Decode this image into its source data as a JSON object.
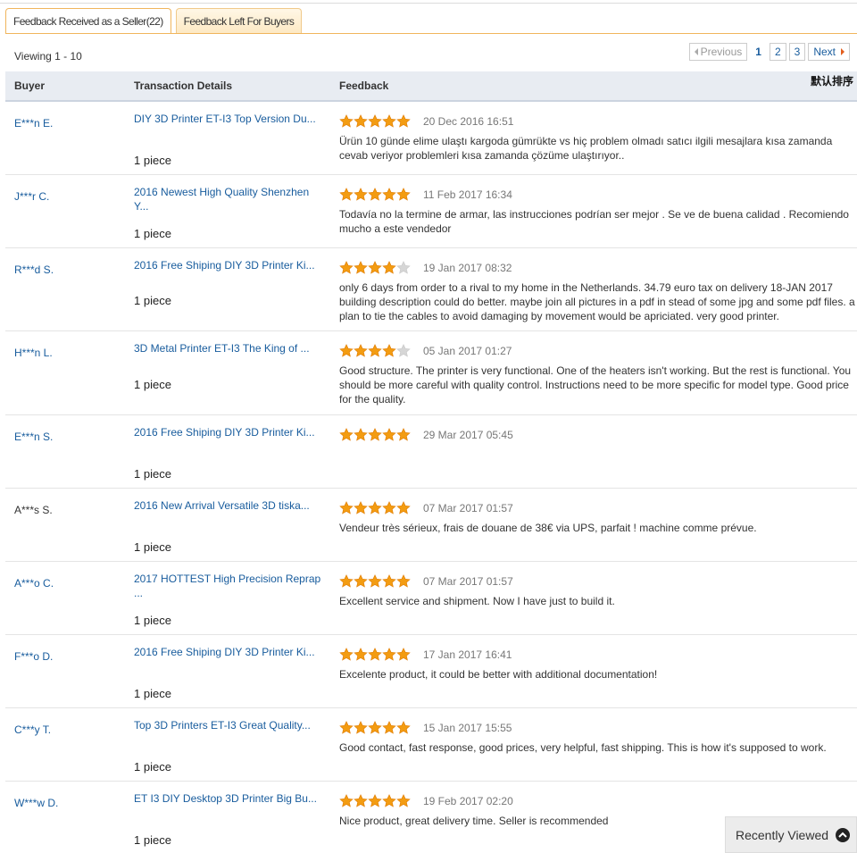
{
  "tabs": [
    {
      "label": "Feedback Received as a Seller(22)",
      "active": true
    },
    {
      "label": "Feedback Left For Buyers",
      "active": false
    }
  ],
  "viewing": "Viewing 1 - 10",
  "pager": {
    "prev": "Previous",
    "pages": [
      "1",
      "2",
      "3"
    ],
    "current": "1",
    "next": "Next"
  },
  "sort_label": "默认排序",
  "table": {
    "headers": {
      "buyer": "Buyer",
      "transaction": "Transaction Details",
      "feedback": "Feedback"
    },
    "rows": [
      {
        "buyer": "E***n E.",
        "buyer_link": true,
        "transaction": "DIY 3D Printer ET-I3 Top Version Du...",
        "quantity": "1 piece",
        "stars": 5,
        "date": "20 Dec 2016 16:51",
        "comment": "Ürün 10 günde elime ulaştı kargoda gümrükte vs hiç problem olmadı satıcı ilgili mesajlara kısa zamanda cevab veriyor problemleri kısa zamanda çözüme ulaştırıyor.."
      },
      {
        "buyer": "J***r C.",
        "buyer_link": true,
        "transaction": "2016 Newest High Quality Shenzhen Y...",
        "quantity": "1 piece",
        "stars": 5,
        "date": "11 Feb 2017 16:34",
        "comment": "Todavía no la termine de armar, las instrucciones podrían ser mejor . Se ve de buena calidad . Recomiendo mucho a este vendedor"
      },
      {
        "buyer": "R***d S.",
        "buyer_link": true,
        "transaction": "2016 Free Shiping DIY 3D Printer Ki...",
        "quantity": "1 piece",
        "stars": 4,
        "date": "19 Jan 2017 08:32",
        "comment": "only 6 days from order to a rival to my home in the Netherlands. 34.79 euro tax on delivery 18-JAN 2017 building description could do better. maybe join all pictures in a pdf in stead of some jpg and some pdf files. a plan to tie the cables to avoid damaging by movement would be apriciated. very good printer."
      },
      {
        "buyer": "H***n L.",
        "buyer_link": true,
        "transaction": "3D Metal Printer ET-I3 The King of ...",
        "quantity": "1 piece",
        "stars": 4,
        "date": "05 Jan 2017 01:27",
        "comment": "Good structure. The printer is very functional. One of the heaters isn't working. But the rest is functional. You should be more careful with quality control. Instructions need to be more specific for model type. Good price for the quality."
      },
      {
        "buyer": "E***n S.",
        "buyer_link": true,
        "transaction": "2016 Free Shiping DIY 3D Printer Ki...",
        "quantity": "1 piece",
        "stars": 5,
        "date": "29 Mar 2017 05:45",
        "comment": ""
      },
      {
        "buyer": "A***s S.",
        "buyer_link": false,
        "transaction": "2016 New Arrival Versatile 3D tiska...",
        "quantity": "1 piece",
        "stars": 5,
        "date": "07 Mar 2017 01:57",
        "comment": "Vendeur très sérieux, frais de douane de 38€ via UPS, parfait ! machine comme prévue."
      },
      {
        "buyer": "A***o C.",
        "buyer_link": true,
        "transaction": "2017 HOTTEST High Precision Reprap ...",
        "quantity": "1 piece",
        "stars": 5,
        "date": "07 Mar 2017 01:57",
        "comment": "Excellent service and shipment. Now I have just to build it."
      },
      {
        "buyer": "F***o D.",
        "buyer_link": true,
        "transaction": "2016 Free Shiping DIY 3D Printer Ki...",
        "quantity": "1 piece",
        "stars": 5,
        "date": "17 Jan 2017 16:41",
        "comment": "Excelente product, it could be better with additional documentation!"
      },
      {
        "buyer": "C***y T.",
        "buyer_link": true,
        "transaction": "Top 3D Printers ET-I3 Great Quality...",
        "quantity": "1 piece",
        "stars": 5,
        "date": "15 Jan 2017 15:55",
        "comment": "Good contact, fast response, good prices, very helpful, fast shipping. This is how it's supposed to work."
      },
      {
        "buyer": "W***w D.",
        "buyer_link": true,
        "transaction": "ET I3 DIY Desktop 3D Printer Big Bu...",
        "quantity": "1 piece",
        "stars": 5,
        "date": "19 Feb 2017 02:20",
        "comment": "Nice product, great delivery time. Seller is recommended"
      }
    ]
  },
  "recently_viewed": "Recently Viewed",
  "colors": {
    "link": "#185c9d",
    "star_on": "#f39c12",
    "star_off": "#d6d6d6",
    "tab_border": "#f0b55c"
  },
  "icons": {
    "star": "star-icon",
    "collapse": "chevron-up-icon"
  }
}
